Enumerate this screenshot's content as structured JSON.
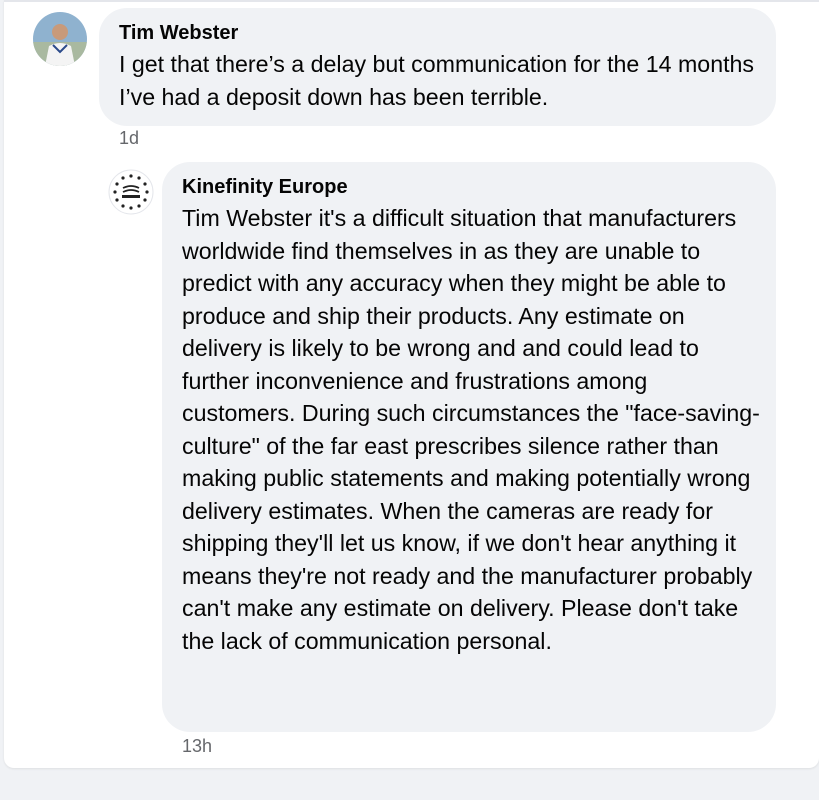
{
  "comments": [
    {
      "author": "Tim Webster",
      "text": "I get that there’s a delay but communication for the 14 months I’ve had a deposit down has been terrible.",
      "timestamp": "1d",
      "avatar_icon": "user-avatar-photo"
    },
    {
      "author": "Kinefinity Europe",
      "text": "Tim Webster it's a difficult situation that manufacturers worldwide find themselves in as they are unable to predict with any accuracy when they might be able to produce and ship their products. Any estimate on delivery is likely to be wrong and and could lead to further inconvenience and frustrations among customers. During such circumstances the \"face-saving-culture\" of the far east prescribes silence rather than making public statements and making potentially wrong delivery estimates. When the cameras are ready for shipping they'll let us know, if we don't hear anything it means they're not ready and the manufacturer probably can't make any estimate on delivery. Please don't take the lack of communication personal.",
      "timestamp": "13h",
      "avatar_icon": "kinefinity-logo-icon"
    }
  ],
  "colors": {
    "bubble": "#f0f2f5",
    "text": "#050505",
    "secondary_text": "#65676b",
    "card": "#ffffff"
  }
}
